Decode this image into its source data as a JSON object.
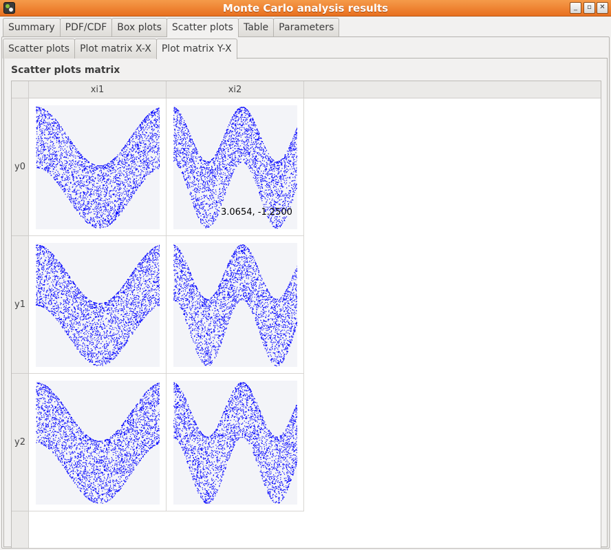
{
  "window": {
    "title": "Monte Carlo analysis results",
    "buttons": {
      "minimize": "_",
      "maximize": "▫",
      "close": "✕"
    }
  },
  "tabs_main": [
    {
      "label": "Summary",
      "active": false
    },
    {
      "label": "PDF/CDF",
      "active": false
    },
    {
      "label": "Box plots",
      "active": false
    },
    {
      "label": "Scatter plots",
      "active": true
    },
    {
      "label": "Table",
      "active": false
    },
    {
      "label": "Parameters",
      "active": false
    }
  ],
  "tabs_sub": [
    {
      "label": "Scatter plots",
      "active": false
    },
    {
      "label": "Plot matrix X-X",
      "active": false
    },
    {
      "label": "Plot matrix Y-X",
      "active": true
    }
  ],
  "group": {
    "title": "Scatter plots matrix"
  },
  "matrix": {
    "columns": [
      "xi1",
      "xi2"
    ],
    "rows": [
      "y0",
      "y1",
      "y2"
    ],
    "point_color": "#0000ff",
    "plot_background": "#f3f4f8",
    "hover_readout": "3.0654, -1.2500"
  }
}
